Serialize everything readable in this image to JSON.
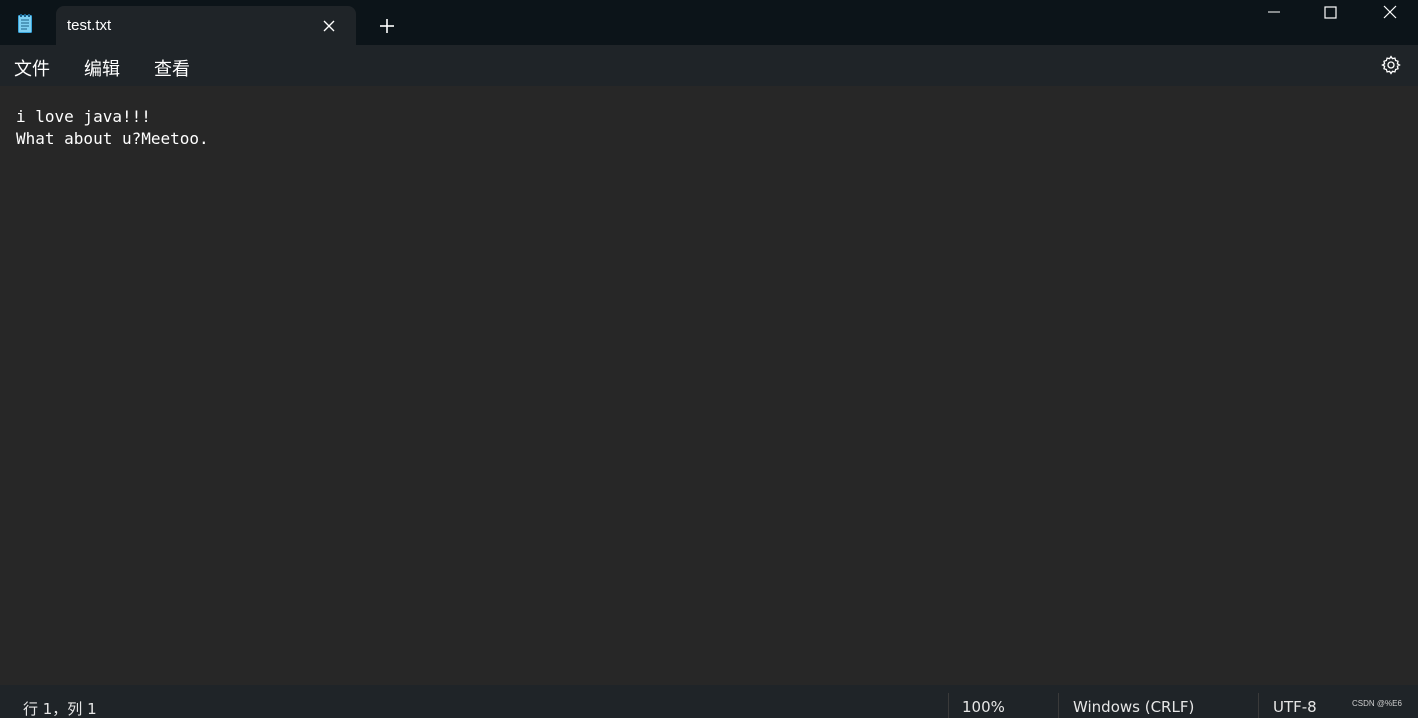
{
  "titlebar": {
    "app_icon": "notepad-icon",
    "tab": {
      "title": "test.txt",
      "close_icon": "close-icon"
    },
    "new_tab_icon": "plus-icon",
    "window_controls": [
      "minimize-icon",
      "maximize-icon",
      "close-icon"
    ]
  },
  "menu": {
    "file": "文件",
    "edit": "编辑",
    "view": "查看",
    "settings_icon": "gear-icon"
  },
  "editor": {
    "lines": [
      "i love java!!!",
      "What about u?Meetoo."
    ]
  },
  "status": {
    "position": "行 1，列 1",
    "zoom": "100%",
    "line_ending": "Windows (CRLF)",
    "encoding": "UTF-8",
    "watermark": "CSDN @%E6"
  },
  "colors": {
    "titlebar_bg": "#0c1419",
    "tab_bg": "#1f2428",
    "editor_bg": "#272727",
    "text": "#ffffff",
    "notepad_icon": "#6ec6ee"
  }
}
